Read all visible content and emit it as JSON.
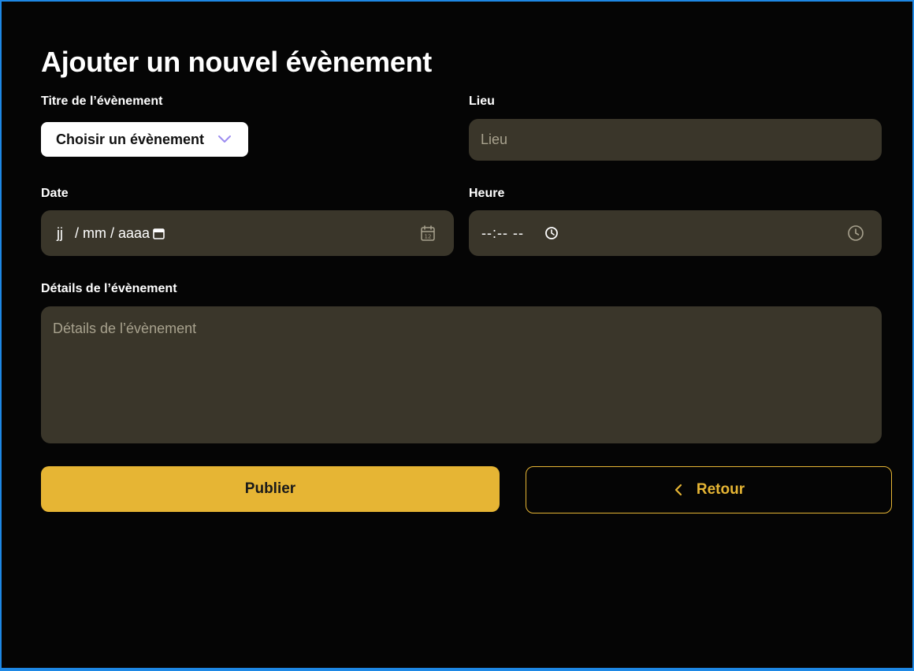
{
  "page": {
    "title": "Ajouter un nouvel évènement"
  },
  "form": {
    "event_title": {
      "label": "Titre de l’évènement",
      "selected": "Choisir un évènement"
    },
    "place": {
      "label": "Lieu",
      "placeholder": "Lieu"
    },
    "date": {
      "label": "Date",
      "placeholder": "jj   / mm / aaaa"
    },
    "time": {
      "label": "Heure",
      "placeholder": "--:-- --"
    },
    "details": {
      "label": "Détails de l’évènement",
      "placeholder": "Détails de l’évènement"
    }
  },
  "actions": {
    "publish_label": "Publier",
    "back_label": "Retour"
  },
  "colors": {
    "accent": "#e6b534",
    "field_bg": "#3a362a",
    "background": "#050505",
    "frame_border": "#1e88e5",
    "chevron": "#9c8cf0"
  },
  "icons": {
    "select": "chevron-down-icon",
    "date": "calendar-icon",
    "time": "clock-icon",
    "back": "chevron-left-icon"
  }
}
